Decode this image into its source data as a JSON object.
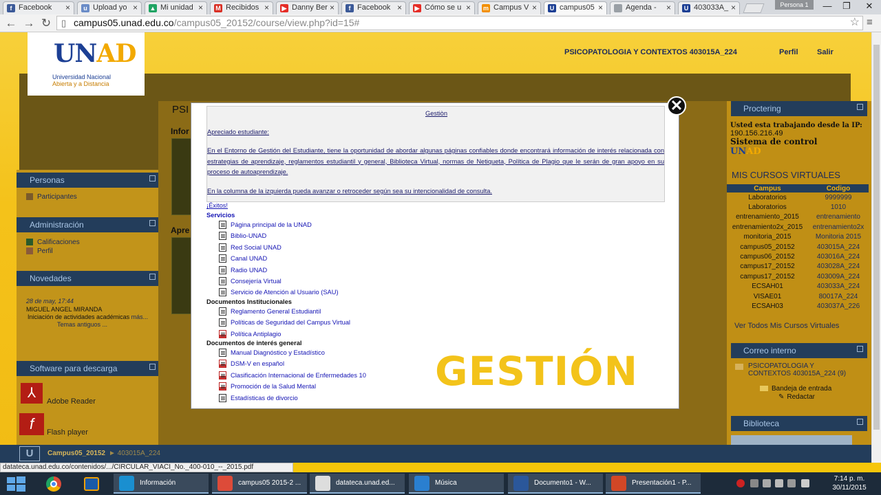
{
  "tabs": [
    {
      "label": "Facebook",
      "icon": "facebook-icon",
      "color": "#3b5998",
      "glyph": "f"
    },
    {
      "label": "Upload yo",
      "icon": "upload-icon",
      "color": "#6a8cc7",
      "glyph": "u"
    },
    {
      "label": "Mi unidad",
      "icon": "drive-icon",
      "color": "#1fa463",
      "glyph": "▲"
    },
    {
      "label": "Recibidos",
      "icon": "gmail-icon",
      "color": "#d93025",
      "glyph": "M"
    },
    {
      "label": "Danny Ber",
      "icon": "youtube-icon",
      "color": "#e52d27",
      "glyph": "▶"
    },
    {
      "label": "Facebook",
      "icon": "facebook-icon",
      "color": "#3b5998",
      "glyph": "f"
    },
    {
      "label": "Cómo se u",
      "icon": "youtube-icon",
      "color": "#e52d27",
      "glyph": "▶"
    },
    {
      "label": "Campus V",
      "icon": "moodle-icon",
      "color": "#f28f00",
      "glyph": "m"
    },
    {
      "label": "campus05",
      "icon": "unad-icon",
      "color": "#1c3f94",
      "glyph": "U",
      "active": true
    },
    {
      "label": "Agenda -",
      "icon": "page-icon",
      "color": "#9aa0a6",
      "glyph": ""
    },
    {
      "label": "403033A_",
      "icon": "unad-icon",
      "color": "#1c3f94",
      "glyph": "U"
    }
  ],
  "profile_label": "Persona 1",
  "url": {
    "host": "campus05.unad.edu.co",
    "path": "/campus05_20152/course/view.php?id=15#"
  },
  "header": {
    "course": "PSICOPATOLOGIA Y CONTEXTOS 403015A_224",
    "perfil": "Perfil",
    "salir": "Salir"
  },
  "logo": {
    "main": "UN",
    "accent": "AD",
    "sub1": "Universidad Nacional",
    "sub2": "Abierta y a Distancia"
  },
  "left": {
    "personas": {
      "title": "Personas",
      "items": [
        "Participantes"
      ]
    },
    "administracion": {
      "title": "Administración",
      "items": [
        "Calificaciones",
        "Perfil"
      ]
    },
    "novedades": {
      "title": "Novedades",
      "date": "28 de may, 17:44",
      "author": "MIGUEL ANGEL MIRANDA",
      "summary": "Iniciación de actividades académicas",
      "more": "más...",
      "old": "Temas antiguos ..."
    },
    "software": {
      "title": "Software para descarga",
      "items": [
        "Adobe Reader",
        "Flash player"
      ]
    }
  },
  "middle": {
    "title_fragment": "PSI",
    "info_fragment": "Infor",
    "apre_fragment": "Apre"
  },
  "right": {
    "proctering": {
      "title": "Proctering",
      "line1": "Usted esta trabajando desde la IP:",
      "ip": "190.156.216.49",
      "sistema": "Sistema de control",
      "brand1": "UN",
      "brand2": "AD"
    },
    "cursos": {
      "title": "MIS CURSOS VIRTUALES",
      "headers": [
        "Campus",
        "Codigo"
      ],
      "rows": [
        [
          "Laboratorios",
          "9999999"
        ],
        [
          "Laboratorios",
          "1010"
        ],
        [
          "entrenamiento_2015",
          "entrenamiento"
        ],
        [
          "entrenamiento2x_2015",
          "entrenamiento2x"
        ],
        [
          "monitoria_2015",
          "Monitoria 2015"
        ],
        [
          "campus05_20152",
          "403015A_224"
        ],
        [
          "campus06_20152",
          "403016A_224"
        ],
        [
          "campus17_20152",
          "403028A_224"
        ],
        [
          "campus17_20152",
          "403009A_224"
        ],
        [
          "ECSAH01",
          "403033A_224"
        ],
        [
          "VISAE01",
          "80017A_224"
        ],
        [
          "ECSAH03",
          "403037A_226"
        ]
      ],
      "ver_todos": "Ver Todos Mis Cursos Virtuales"
    },
    "correo": {
      "title": "Correo interno",
      "course": "PSICOPATOLOGIA Y CONTEXTOS 403015A_224",
      "count": "(9)",
      "bandeja": "Bandeja de entrada",
      "redactar": "Redactar"
    },
    "biblioteca": {
      "title": "Biblioteca"
    }
  },
  "bottom_bar": {
    "crumb1": "Campus05_20152",
    "crumb2": "► 403015A_224"
  },
  "modal": {
    "title": "Gestiòn",
    "greeting": "Apreciado estudiante:",
    "body": "En el Entorno de Gestión del Estudiante, tiene la oportunidad de abordar algunas páginas confiables donde encontrará información de interés relacionada con estrategias de aprendizaje, reglamentos estudiantil y general, Biblioteca Virtual, normas de Netiqueta, Política de Plagio que le serán de gran apoyo en su proceso de autoaprendizaje.",
    "instruction": "En la columna de la izquierda pueda avanzar o retroceder según sea su intencionalidad de consulta.",
    "exitos": "¡Éxitos!",
    "sections": [
      {
        "title": "Servicios",
        "blue": true,
        "links": [
          {
            "label": "Página principal de la UNAD",
            "type": "doc"
          },
          {
            "label": "Biblio-UNAD",
            "type": "doc"
          },
          {
            "label": "Red Social UNAD",
            "type": "doc"
          },
          {
            "label": "Canal UNAD",
            "type": "doc"
          },
          {
            "label": "Radio UNAD",
            "type": "doc"
          },
          {
            "label": "Consejería Virtual",
            "type": "doc"
          },
          {
            "label": "Servicio de Atención al Usuario (SAU)",
            "type": "doc"
          }
        ]
      },
      {
        "title": "Documentos Institucionales",
        "blue": false,
        "links": [
          {
            "label": "Reglamento General Estudiantil",
            "type": "doc"
          },
          {
            "label": "Políticas de Seguridad del Campus Virtual",
            "type": "doc"
          },
          {
            "label": "Política Antiplagio",
            "type": "pdf"
          }
        ]
      },
      {
        "title": "Documentos de interés general",
        "blue": false,
        "links": [
          {
            "label": "Manual Diagnóstico y Estadístico",
            "type": "doc"
          },
          {
            "label": "DSM-V en español",
            "type": "pdf"
          },
          {
            "label": "Clasificación Internacional de Enfermedades 10",
            "type": "pdf"
          },
          {
            "label": "Promoción de la Salud Mental",
            "type": "pdf"
          },
          {
            "label": "Estadísticas de divorcio",
            "type": "doc"
          }
        ]
      }
    ],
    "overlay_title": "GESTIÓN"
  },
  "status_url": "datateca.unad.edu.co/contenidos/.../CIRCULAR_VIACI_No._400-010_--_2015.pdf",
  "taskbar": {
    "items": [
      {
        "label": "Información",
        "icon": "info-app-icon",
        "color": "#1a8fd0"
      },
      {
        "label": "campus05 2015-2 ...",
        "icon": "chrome-icon",
        "color": "#dd4b39"
      },
      {
        "label": "datateca.unad.ed...",
        "icon": "file-icon",
        "color": "#ddd"
      },
      {
        "label": "Música",
        "icon": "music-icon",
        "color": "#2a7fd0"
      },
      {
        "label": "Documento1 - W...",
        "icon": "word-icon",
        "color": "#2b579a"
      },
      {
        "label": "Presentación1 - P...",
        "icon": "powerpoint-icon",
        "color": "#d24726"
      }
    ],
    "time": "7:14 p. m.",
    "date": "30/11/2015"
  }
}
